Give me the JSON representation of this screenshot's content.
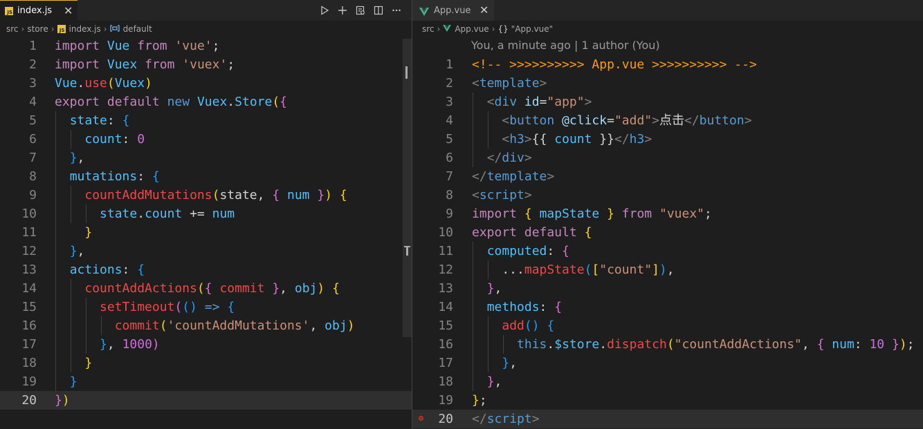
{
  "colors": {
    "keyword": "#c586c0",
    "control": "#c586c0",
    "storage": "#569cd6",
    "identifier": "#4fc1ff",
    "property": "#4fc1ff",
    "function": "#f44747",
    "string": "#ce9178",
    "number": "#d16de2",
    "plain": "#d4d4d4",
    "punct": "#d4d4d4",
    "bracket1": "#ffd700",
    "bracket2": "#da70d6",
    "bracket3": "#179fff",
    "tag": "#808080",
    "tagname": "#569cd6",
    "attr": "#9cdcfe",
    "comment": "#ff9d00",
    "blueKw": "#569cd6"
  },
  "left_editor": {
    "tab_label": "index.js",
    "tab_icon": "js-file-icon",
    "breadcrumb": [
      "src",
      "store",
      "index.js",
      "default"
    ],
    "current_line": 20,
    "lines": [
      [
        [
          "import",
          "kw"
        ],
        [
          " ",
          "p"
        ],
        [
          "Vue",
          "id"
        ],
        [
          " ",
          "p"
        ],
        [
          "from",
          "kw"
        ],
        [
          " ",
          "p"
        ],
        [
          "'vue'",
          "str"
        ],
        [
          ";",
          "p"
        ]
      ],
      [
        [
          "import",
          "kw"
        ],
        [
          " ",
          "p"
        ],
        [
          "Vuex",
          "id"
        ],
        [
          " ",
          "p"
        ],
        [
          "from",
          "kw"
        ],
        [
          " ",
          "p"
        ],
        [
          "'vuex'",
          "str"
        ],
        [
          ";",
          "p"
        ]
      ],
      [
        [
          "Vue",
          "id"
        ],
        [
          ".",
          "p"
        ],
        [
          "use",
          "fn"
        ],
        [
          "(",
          "b1"
        ],
        [
          "Vuex",
          "id"
        ],
        [
          ")",
          "b1"
        ]
      ],
      [
        [
          "export",
          "kw"
        ],
        [
          " ",
          "p"
        ],
        [
          "default",
          "kw"
        ],
        [
          " ",
          "p"
        ],
        [
          "new",
          "bk"
        ],
        [
          " ",
          "p"
        ],
        [
          "Vuex",
          "id"
        ],
        [
          ".",
          "p"
        ],
        [
          "Store",
          "id"
        ],
        [
          "(",
          "b1"
        ],
        [
          "{",
          "b2"
        ]
      ],
      [
        [
          "  ",
          "p"
        ],
        [
          "state",
          "prop"
        ],
        [
          ": ",
          "p"
        ],
        [
          "{",
          "b3"
        ]
      ],
      [
        [
          "    ",
          "p"
        ],
        [
          "count",
          "prop"
        ],
        [
          ": ",
          "p"
        ],
        [
          "0",
          "num"
        ]
      ],
      [
        [
          "  ",
          "p"
        ],
        [
          "}",
          "b3"
        ],
        [
          ",",
          "p"
        ]
      ],
      [
        [
          "  ",
          "p"
        ],
        [
          "mutations",
          "prop"
        ],
        [
          ": ",
          "p"
        ],
        [
          "{",
          "b3"
        ]
      ],
      [
        [
          "    ",
          "p"
        ],
        [
          "countAddMutations",
          "fn"
        ],
        [
          "(",
          "b1"
        ],
        [
          "state",
          "p"
        ],
        [
          ", ",
          "p"
        ],
        [
          "{",
          "b2"
        ],
        [
          " ",
          "p"
        ],
        [
          "num",
          "prop"
        ],
        [
          " ",
          "p"
        ],
        [
          "}",
          "b2"
        ],
        [
          ")",
          "b1"
        ],
        [
          " ",
          "p"
        ],
        [
          "{",
          "b1"
        ]
      ],
      [
        [
          "      ",
          "p"
        ],
        [
          "state",
          "id"
        ],
        [
          ".",
          "p"
        ],
        [
          "count",
          "prop"
        ],
        [
          " += ",
          "p"
        ],
        [
          "num",
          "id"
        ]
      ],
      [
        [
          "    ",
          "p"
        ],
        [
          "}",
          "b1"
        ]
      ],
      [
        [
          "  ",
          "p"
        ],
        [
          "}",
          "b3"
        ],
        [
          ",",
          "p"
        ]
      ],
      [
        [
          "  ",
          "p"
        ],
        [
          "actions",
          "prop"
        ],
        [
          ": ",
          "p"
        ],
        [
          "{",
          "b3"
        ]
      ],
      [
        [
          "    ",
          "p"
        ],
        [
          "countAddActions",
          "fn"
        ],
        [
          "(",
          "b1"
        ],
        [
          "{",
          "b2"
        ],
        [
          " ",
          "p"
        ],
        [
          "commit",
          "fn"
        ],
        [
          " ",
          "p"
        ],
        [
          "}",
          "b2"
        ],
        [
          ", ",
          "p"
        ],
        [
          "obj",
          "id"
        ],
        [
          ")",
          "b1"
        ],
        [
          " ",
          "p"
        ],
        [
          "{",
          "b1"
        ]
      ],
      [
        [
          "      ",
          "p"
        ],
        [
          "setTimeout",
          "fn"
        ],
        [
          "(",
          "b2"
        ],
        [
          "()",
          "b3"
        ],
        [
          " ",
          "p"
        ],
        [
          "=>",
          "bk"
        ],
        [
          " ",
          "p"
        ],
        [
          "{",
          "b3"
        ]
      ],
      [
        [
          "        ",
          "p"
        ],
        [
          "commit",
          "fn"
        ],
        [
          "(",
          "b1"
        ],
        [
          "'countAddMutations'",
          "str"
        ],
        [
          ", ",
          "p"
        ],
        [
          "obj",
          "id"
        ],
        [
          ")",
          "b1"
        ]
      ],
      [
        [
          "      ",
          "p"
        ],
        [
          "}",
          "b3"
        ],
        [
          ", ",
          "p"
        ],
        [
          "1000",
          "num"
        ],
        [
          ")",
          "b2"
        ]
      ],
      [
        [
          "    ",
          "p"
        ],
        [
          "}",
          "b1"
        ]
      ],
      [
        [
          "  ",
          "p"
        ],
        [
          "}",
          "b3"
        ]
      ],
      [
        [
          "}",
          "b2"
        ],
        [
          ")",
          "b1"
        ]
      ]
    ]
  },
  "right_editor": {
    "tab_label": "App.vue",
    "tab_icon": "vue-file-icon",
    "breadcrumb": [
      "src",
      "App.vue",
      "\"App.vue\""
    ],
    "blame": "You, a minute ago | 1 author (You)",
    "current_line": 20,
    "lines": [
      [
        [
          "<!-- >>>>>>>>>> App.vue >>>>>>>>>> -->",
          "cm"
        ]
      ],
      [
        [
          "<",
          "tag"
        ],
        [
          "template",
          "tn"
        ],
        [
          ">",
          "tag"
        ]
      ],
      [
        [
          "  ",
          "p"
        ],
        [
          "<",
          "tag"
        ],
        [
          "div",
          "tn"
        ],
        [
          " ",
          "p"
        ],
        [
          "id",
          "attr"
        ],
        [
          "=",
          "p"
        ],
        [
          "\"app\"",
          "str"
        ],
        [
          ">",
          "tag"
        ]
      ],
      [
        [
          "    ",
          "p"
        ],
        [
          "<",
          "tag"
        ],
        [
          "button",
          "tn"
        ],
        [
          " ",
          "p"
        ],
        [
          "@click",
          "attr"
        ],
        [
          "=",
          "p"
        ],
        [
          "\"add\"",
          "str"
        ],
        [
          ">",
          "tag"
        ],
        [
          "点击",
          "p"
        ],
        [
          "</",
          "tag"
        ],
        [
          "button",
          "tn"
        ],
        [
          ">",
          "tag"
        ]
      ],
      [
        [
          "    ",
          "p"
        ],
        [
          "<",
          "tag"
        ],
        [
          "h3",
          "tn"
        ],
        [
          ">",
          "tag"
        ],
        [
          "{{",
          "p"
        ],
        [
          " ",
          "p"
        ],
        [
          "count",
          "prop"
        ],
        [
          " ",
          "p"
        ],
        [
          "}}",
          "p"
        ],
        [
          "</",
          "tag"
        ],
        [
          "h3",
          "tn"
        ],
        [
          ">",
          "tag"
        ]
      ],
      [
        [
          "  ",
          "p"
        ],
        [
          "</",
          "tag"
        ],
        [
          "div",
          "tn"
        ],
        [
          ">",
          "tag"
        ]
      ],
      [
        [
          "</",
          "tag"
        ],
        [
          "template",
          "tn"
        ],
        [
          ">",
          "tag"
        ]
      ],
      [
        [
          "<",
          "tag"
        ],
        [
          "script",
          "tn"
        ],
        [
          ">",
          "tag"
        ]
      ],
      [
        [
          "import",
          "kw"
        ],
        [
          " ",
          "p"
        ],
        [
          "{",
          "b1"
        ],
        [
          " ",
          "p"
        ],
        [
          "mapState",
          "id"
        ],
        [
          " ",
          "p"
        ],
        [
          "}",
          "b1"
        ],
        [
          " ",
          "p"
        ],
        [
          "from",
          "kw"
        ],
        [
          " ",
          "p"
        ],
        [
          "\"vuex\"",
          "str"
        ],
        [
          ";",
          "p"
        ]
      ],
      [
        [
          "export",
          "kw"
        ],
        [
          " ",
          "p"
        ],
        [
          "default",
          "kw"
        ],
        [
          " ",
          "p"
        ],
        [
          "{",
          "b1"
        ]
      ],
      [
        [
          "  ",
          "p"
        ],
        [
          "computed",
          "prop"
        ],
        [
          ": ",
          "p"
        ],
        [
          "{",
          "b2"
        ]
      ],
      [
        [
          "    ...",
          "p"
        ],
        [
          "mapState",
          "fn"
        ],
        [
          "(",
          "b3"
        ],
        [
          "[",
          "b1"
        ],
        [
          "\"count\"",
          "str"
        ],
        [
          "]",
          "b1"
        ],
        [
          ")",
          "b3"
        ],
        [
          ",",
          "p"
        ]
      ],
      [
        [
          "  ",
          "p"
        ],
        [
          "}",
          "b2"
        ],
        [
          ",",
          "p"
        ]
      ],
      [
        [
          "  ",
          "p"
        ],
        [
          "methods",
          "prop"
        ],
        [
          ": ",
          "p"
        ],
        [
          "{",
          "b2"
        ]
      ],
      [
        [
          "    ",
          "p"
        ],
        [
          "add",
          "fn"
        ],
        [
          "()",
          "b3"
        ],
        [
          " ",
          "p"
        ],
        [
          "{",
          "b3"
        ]
      ],
      [
        [
          "      ",
          "p"
        ],
        [
          "this",
          "bk"
        ],
        [
          ".",
          "p"
        ],
        [
          "$store",
          "id"
        ],
        [
          ".",
          "p"
        ],
        [
          "dispatch",
          "fn"
        ],
        [
          "(",
          "b1"
        ],
        [
          "\"countAddActions\"",
          "str"
        ],
        [
          ", ",
          "p"
        ],
        [
          "{",
          "b2"
        ],
        [
          " ",
          "p"
        ],
        [
          "num",
          "prop"
        ],
        [
          ": ",
          "p"
        ],
        [
          "10",
          "num"
        ],
        [
          " ",
          "p"
        ],
        [
          "}",
          "b2"
        ],
        [
          ")",
          "b1"
        ],
        [
          ";",
          "p"
        ]
      ],
      [
        [
          "    ",
          "p"
        ],
        [
          "}",
          "b3"
        ],
        [
          ",",
          "p"
        ]
      ],
      [
        [
          "  ",
          "p"
        ],
        [
          "}",
          "b2"
        ],
        [
          ",",
          "p"
        ]
      ],
      [
        [
          "}",
          "b1"
        ],
        [
          ";",
          "p"
        ]
      ],
      [
        [
          "</",
          "tag"
        ],
        [
          "script",
          "tn"
        ],
        [
          ">",
          "tag"
        ]
      ]
    ]
  }
}
